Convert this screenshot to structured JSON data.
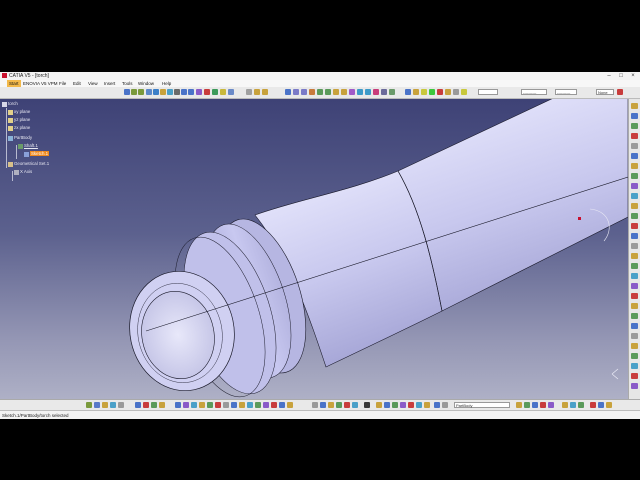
{
  "window": {
    "title": "CATIA V5 - [torch]"
  },
  "menu": [
    "Start",
    "ENOVIA V5 VPM",
    "File",
    "Edit",
    "View",
    "Insert",
    "Tools",
    "Window",
    "Help"
  ],
  "tree": {
    "root": "torch",
    "items": [
      "xy plane",
      "yz plane",
      "zx plane",
      "PartBody",
      "Shaft.1",
      "Sketch.1",
      "Geometrical Set.1",
      "X Axis"
    ]
  },
  "toolbar": {
    "line_type_combo": "----------",
    "line_weight_combo": "----------",
    "layer_combo": "None",
    "body_combo": "PartBody"
  },
  "status_bar": {
    "text": "Sketch.1/PartBody/torch selected"
  },
  "colors": {
    "selection": "#f08a1e",
    "brand": "#c8102e",
    "model_surface": "#ccccf2"
  }
}
